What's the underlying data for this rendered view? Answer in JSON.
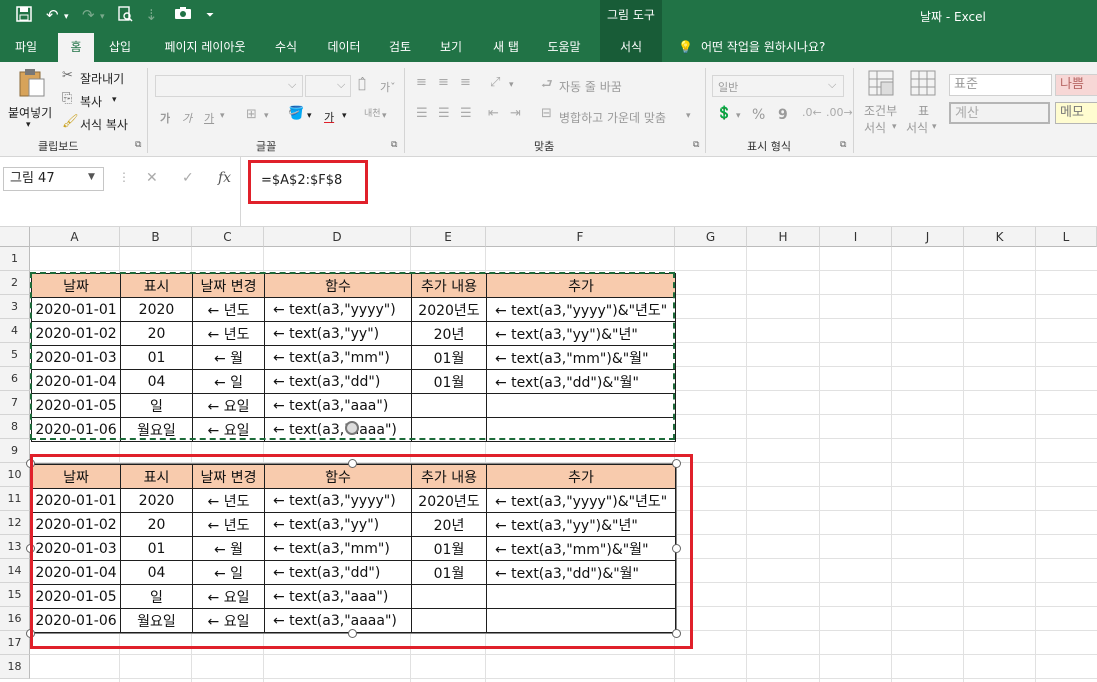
{
  "titlebar": {
    "context_tab": "그림 도구",
    "doc_title": "날짜  -  Excel",
    "icons": [
      "save-icon",
      "undo-icon",
      "redo-icon",
      "print-preview-icon",
      "sort-icon",
      "camera-icon",
      "customize-qat-icon"
    ]
  },
  "tabs": {
    "file": "파일",
    "home": "홈",
    "insert": "삽입",
    "page_layout": "페이지 레이아웃",
    "formulas": "수식",
    "data": "데이터",
    "review": "검토",
    "view": "보기",
    "new_tab": "새 탭",
    "help": "도움말",
    "format": "서식",
    "tell_me": "어떤 작업을 원하시나요?"
  },
  "ribbon": {
    "clipboard": {
      "paste": "붙여넣기",
      "cut": "잘라내기",
      "copy": "복사",
      "format_painter": "서식 복사",
      "group_label": "클립보드"
    },
    "font": {
      "group_label": "글꼴",
      "bold": "가",
      "italic": "가",
      "underline": "가",
      "font_color": "가",
      "phonetic": "내천"
    },
    "alignment": {
      "wrap_text": "자동 줄 바꿈",
      "merge_center": "병합하고 가운데 맞춤",
      "group_label": "맞춤"
    },
    "number": {
      "format_value": "일반",
      "percent": "%",
      "comma": "9",
      "group_label": "표시 형식"
    },
    "styles": {
      "conditional": "조건부\n서식",
      "conditional_line1": "조건부",
      "conditional_line2": "서식",
      "table_line1": "표",
      "table_line2": "서식",
      "normal": "표준",
      "bad": "나쁨",
      "calculation": "계산",
      "note": "메모"
    }
  },
  "formula_bar": {
    "name_box": "그림 47",
    "formula": "=$A$2:$F$8",
    "fx": "fx"
  },
  "grid": {
    "columns": [
      "A",
      "B",
      "C",
      "D",
      "E",
      "F",
      "G",
      "H",
      "I",
      "J",
      "K",
      "L"
    ],
    "rows": [
      "1",
      "2",
      "3",
      "4",
      "5",
      "6",
      "7",
      "8",
      "9",
      "10",
      "11",
      "12",
      "13",
      "14",
      "15",
      "16",
      "17",
      "18"
    ]
  },
  "table": {
    "headers": [
      "날짜",
      "표시",
      "날짜 변경",
      "함수",
      "추가 내용",
      "추가"
    ],
    "rows": [
      [
        "2020-01-01",
        "2020",
        "← 년도",
        "← text(a3,\"yyyy\")",
        "2020년도",
        "← text(a3,\"yyyy\")&\"년도\""
      ],
      [
        "2020-01-02",
        "20",
        "← 년도",
        "← text(a3,\"yy\")",
        "20년",
        "← text(a3,\"yy\")&\"년\""
      ],
      [
        "2020-01-03",
        "01",
        "← 월",
        "← text(a3,\"mm\")",
        "01월",
        "← text(a3,\"mm\")&\"월\""
      ],
      [
        "2020-01-04",
        "04",
        "← 일",
        "← text(a3,\"dd\")",
        "01월",
        "← text(a3,\"dd\")&\"월\""
      ],
      [
        "2020-01-05",
        "일",
        "← 요일",
        "← text(a3,\"aaa\")",
        "",
        ""
      ],
      [
        "2020-01-06",
        "월요일",
        "← 요일",
        "← text(a3,\"aaaa\")",
        "",
        ""
      ]
    ]
  },
  "picture_table": {
    "headers": [
      "날짜",
      "표시",
      "날짜 변경",
      "함수",
      "추가 내용",
      "추가"
    ],
    "rows": [
      [
        "2020-01-01",
        "2020",
        "← 년도",
        "← text(a3,\"yyyy\")",
        "2020년도",
        "← text(a3,\"yyyy\")&\"년도\""
      ],
      [
        "2020-01-02",
        "20",
        "← 년도",
        "← text(a3,\"yy\")",
        "20년",
        "← text(a3,\"yy\")&\"년\""
      ],
      [
        "2020-01-03",
        "01",
        "← 월",
        "← text(a3,\"mm\")",
        "01월",
        "← text(a3,\"mm\")&\"월\""
      ],
      [
        "2020-01-04",
        "04",
        "← 일",
        "← text(a3,\"dd\")",
        "01월",
        "← text(a3,\"dd\")&\"월\""
      ],
      [
        "2020-01-05",
        "일",
        "← 요일",
        "← text(a3,\"aaa\")",
        "",
        ""
      ],
      [
        "2020-01-06",
        "월요일",
        "← 요일",
        "← text(a3,\"aaaa\")",
        "",
        ""
      ]
    ]
  },
  "colors": {
    "excel_green": "#217346",
    "header_fill": "#f8cbad",
    "highlight_red": "#e0202a",
    "marquee_green": "#1d6b3a"
  }
}
